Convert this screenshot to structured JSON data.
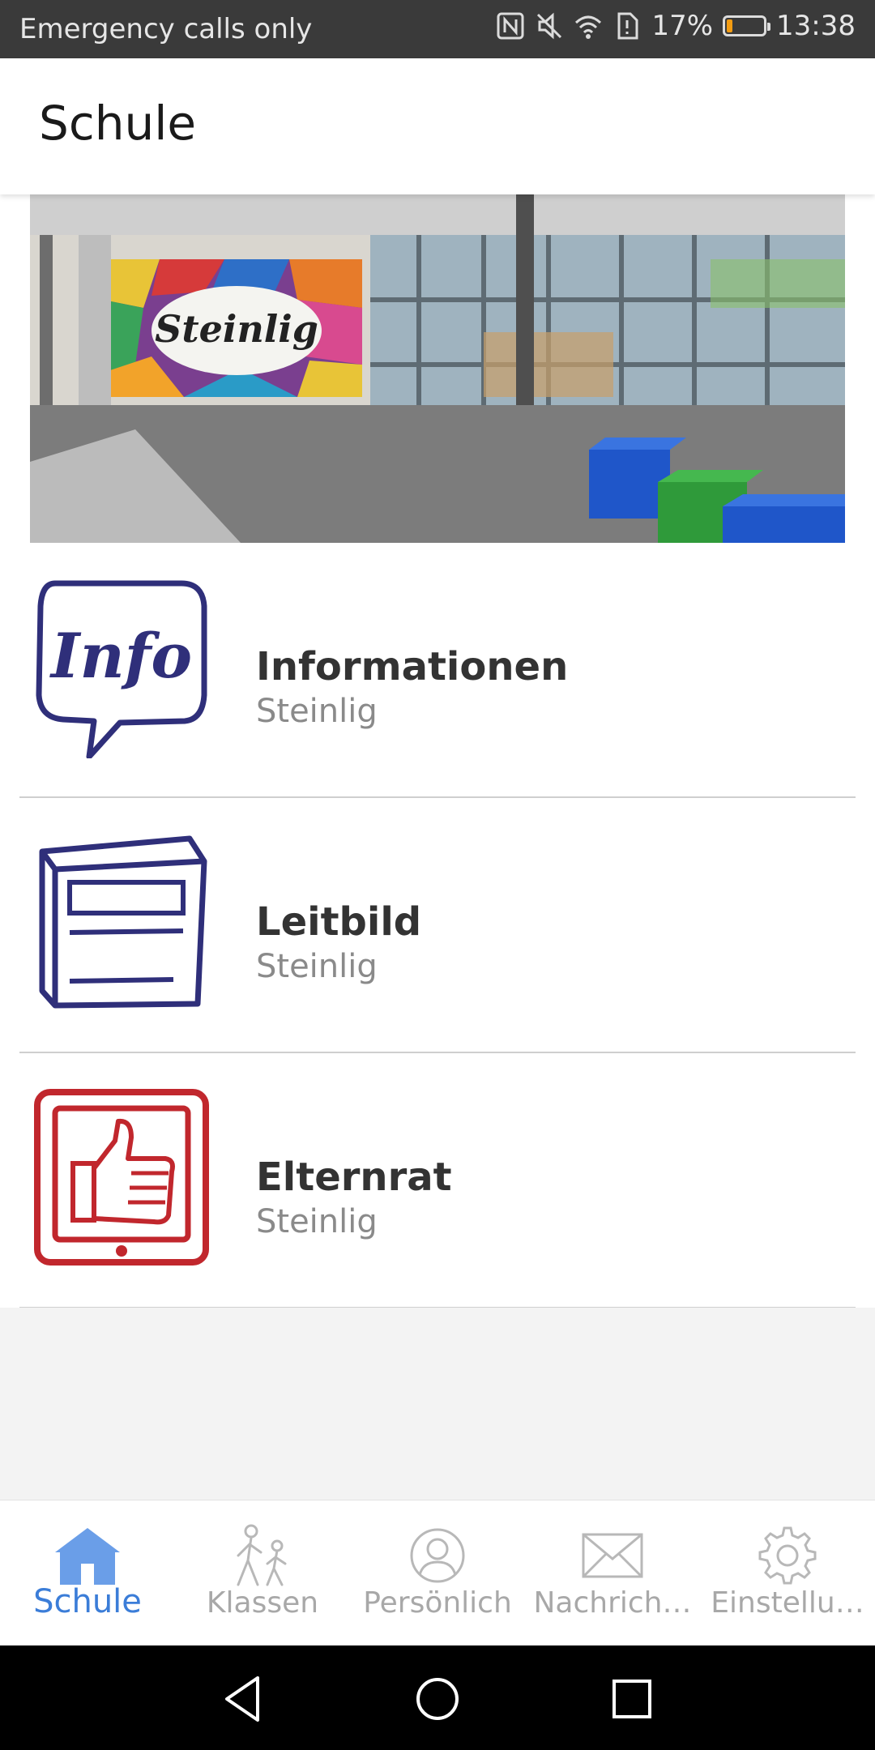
{
  "status_bar": {
    "carrier_text": "Emergency calls only",
    "battery_percent": "17%",
    "battery_level": 0.17,
    "time": "13:38",
    "icons": [
      "nfc-icon",
      "mute-icon",
      "wifi-icon",
      "sim-icon",
      "battery-icon"
    ]
  },
  "header": {
    "title": "Schule"
  },
  "hero": {
    "image_text": "Steinlig"
  },
  "list": {
    "items": [
      {
        "title": "Informationen",
        "subtitle": "Steinlig",
        "icon": "info-bubble-icon",
        "icon_text": "Info",
        "color": "#3a3a8a"
      },
      {
        "title": "Leitbild",
        "subtitle": "Steinlig",
        "icon": "book-icon",
        "color": "#3a3a8a"
      },
      {
        "title": "Elternrat",
        "subtitle": "Steinlig",
        "icon": "thumbs-up-tablet-icon",
        "color": "#c1272d"
      }
    ]
  },
  "tabs": [
    {
      "label": "Schule",
      "icon": "school-icon",
      "active": true
    },
    {
      "label": "Klassen",
      "icon": "walking-people-icon",
      "active": false
    },
    {
      "label": "Persönlich",
      "icon": "person-icon",
      "active": false
    },
    {
      "label": "Nachrich…",
      "icon": "envelope-icon",
      "active": false
    },
    {
      "label": "Einstellu…",
      "icon": "gear-icon",
      "active": false
    }
  ],
  "colors": {
    "accent": "#3b7dd8",
    "inactive": "#a8a8a8",
    "statusbar": "#3a3a3a"
  },
  "nav": {
    "icons": [
      "back-icon",
      "home-icon",
      "recents-icon"
    ]
  }
}
